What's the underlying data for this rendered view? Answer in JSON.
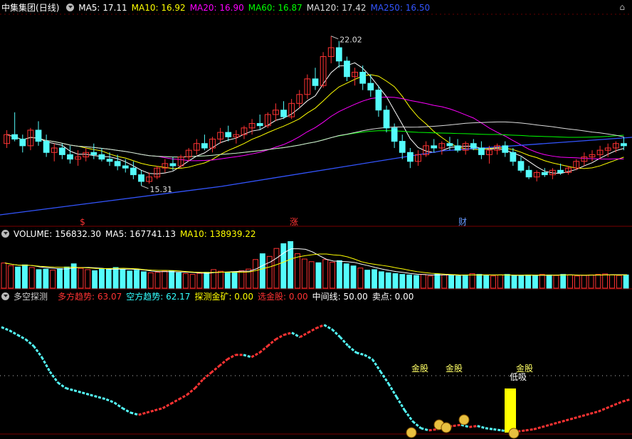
{
  "panel1": {
    "stock": "中集集团",
    "period": "(日线)",
    "indicators": [
      {
        "name": "MA5",
        "value": "17.11",
        "color": "#ffffff"
      },
      {
        "name": "MA10",
        "value": "16.92",
        "color": "#ffff00"
      },
      {
        "name": "MA20",
        "value": "16.90",
        "color": "#ff00ff"
      },
      {
        "name": "MA60",
        "value": "16.87",
        "color": "#00ff00"
      },
      {
        "name": "MA120",
        "value": "17.42",
        "color": "#dddddd"
      },
      {
        "name": "MA250",
        "value": "16.50",
        "color": "#3355ff"
      }
    ],
    "high_label": "22.02",
    "low_label": "15.31",
    "events": [
      "$",
      "涨",
      "财"
    ]
  },
  "panel2": {
    "title": "VOLUME",
    "items": [
      {
        "name": "VOLUME",
        "value": "156832.30",
        "color": "#ffffff"
      },
      {
        "name": "MA5",
        "value": "167741.13",
        "color": "#ffffff"
      },
      {
        "name": "MA10",
        "value": "138939.22",
        "color": "#ffff00"
      }
    ]
  },
  "panel3": {
    "title": "多空探测",
    "items": [
      {
        "name": "多方趋势",
        "value": "63.07",
        "color": "#ff3333"
      },
      {
        "name": "空方趋势",
        "value": "62.17",
        "color": "#33ffff"
      },
      {
        "name": "探测金矿",
        "value": "0.00",
        "color": "#ffff00"
      },
      {
        "name": "选金股",
        "value": "0.00",
        "color": "#ff3333"
      },
      {
        "name": "中间线",
        "value": "50.00",
        "color": "#ffffff"
      },
      {
        "name": "卖点",
        "value": "0.00",
        "color": "#ffffff"
      }
    ],
    "signals": [
      "金股",
      "金股",
      "金股"
    ],
    "low_buy": "低吸"
  },
  "colors": {
    "up": "#ff3333",
    "down": "#54fcfc",
    "bg": "#000000",
    "grid": "#7a0000"
  },
  "chart_data": {
    "type": "candlestick",
    "ohlc": [
      [
        17.2,
        17.8,
        17.0,
        17.6
      ],
      [
        17.6,
        18.6,
        17.3,
        17.4
      ],
      [
        17.4,
        17.6,
        16.8,
        17.1
      ],
      [
        17.1,
        17.9,
        16.9,
        17.8
      ],
      [
        17.8,
        18.2,
        17.1,
        17.3
      ],
      [
        17.3,
        17.6,
        16.6,
        16.8
      ],
      [
        16.8,
        17.2,
        16.4,
        17.0
      ],
      [
        17.0,
        17.2,
        16.5,
        16.7
      ],
      [
        16.7,
        17.1,
        16.3,
        16.5
      ],
      [
        16.5,
        16.9,
        16.2,
        16.6
      ],
      [
        16.6,
        17.0,
        16.4,
        16.8
      ],
      [
        16.8,
        17.2,
        16.5,
        16.7
      ],
      [
        16.7,
        17.0,
        16.4,
        16.5
      ],
      [
        16.5,
        16.8,
        16.2,
        16.4
      ],
      [
        16.4,
        16.7,
        16.0,
        16.2
      ],
      [
        16.2,
        16.5,
        15.9,
        16.1
      ],
      [
        16.1,
        16.4,
        15.6,
        15.8
      ],
      [
        15.8,
        16.0,
        15.31,
        15.5
      ],
      [
        15.5,
        15.9,
        15.4,
        15.7
      ],
      [
        15.7,
        16.2,
        15.6,
        16.1
      ],
      [
        16.1,
        16.5,
        15.9,
        16.3
      ],
      [
        16.3,
        16.6,
        16.0,
        16.2
      ],
      [
        16.2,
        16.7,
        16.1,
        16.6
      ],
      [
        16.6,
        17.0,
        16.4,
        16.9
      ],
      [
        16.9,
        17.4,
        16.7,
        17.2
      ],
      [
        17.2,
        17.6,
        16.9,
        17.0
      ],
      [
        17.0,
        17.5,
        16.8,
        17.4
      ],
      [
        17.4,
        17.9,
        17.2,
        17.7
      ],
      [
        17.7,
        18.0,
        17.3,
        17.5
      ],
      [
        17.5,
        17.8,
        17.2,
        17.6
      ],
      [
        17.6,
        18.0,
        17.4,
        17.9
      ],
      [
        17.9,
        18.3,
        17.6,
        18.1
      ],
      [
        18.1,
        18.5,
        17.8,
        18.0
      ],
      [
        18.0,
        18.6,
        17.9,
        18.5
      ],
      [
        18.5,
        19.0,
        18.2,
        18.7
      ],
      [
        18.7,
        19.1,
        18.3,
        18.4
      ],
      [
        18.4,
        19.2,
        18.3,
        19.0
      ],
      [
        19.0,
        19.6,
        18.8,
        19.4
      ],
      [
        19.4,
        20.3,
        19.2,
        20.1
      ],
      [
        20.1,
        20.6,
        19.6,
        19.8
      ],
      [
        19.8,
        21.3,
        19.7,
        21.1
      ],
      [
        21.1,
        22.02,
        20.8,
        21.5
      ],
      [
        21.5,
        21.8,
        20.6,
        20.9
      ],
      [
        20.9,
        21.1,
        20.0,
        20.2
      ],
      [
        20.2,
        20.6,
        19.8,
        20.4
      ],
      [
        20.4,
        20.7,
        19.6,
        19.9
      ],
      [
        19.9,
        20.3,
        19.3,
        19.6
      ],
      [
        19.6,
        19.8,
        18.4,
        18.7
      ],
      [
        18.7,
        18.9,
        17.7,
        17.9
      ],
      [
        17.9,
        18.1,
        17.0,
        17.3
      ],
      [
        17.3,
        17.6,
        16.5,
        16.8
      ],
      [
        16.8,
        17.0,
        16.1,
        16.4
      ],
      [
        16.4,
        16.9,
        16.2,
        16.7
      ],
      [
        16.7,
        17.3,
        16.6,
        17.1
      ],
      [
        17.1,
        17.4,
        16.8,
        17.0
      ],
      [
        17.0,
        17.3,
        16.7,
        17.2
      ],
      [
        17.2,
        17.5,
        16.9,
        17.1
      ],
      [
        17.1,
        17.4,
        16.8,
        16.9
      ],
      [
        16.9,
        17.3,
        16.7,
        17.2
      ],
      [
        17.2,
        17.4,
        16.9,
        17.0
      ],
      [
        17.0,
        17.3,
        16.5,
        16.7
      ],
      [
        16.7,
        17.1,
        16.3,
        16.9
      ],
      [
        16.9,
        17.2,
        16.7,
        17.1
      ],
      [
        17.1,
        17.3,
        16.6,
        16.8
      ],
      [
        16.8,
        17.0,
        16.2,
        16.4
      ],
      [
        16.4,
        16.6,
        15.9,
        16.0
      ],
      [
        16.0,
        16.2,
        15.6,
        15.7
      ],
      [
        15.7,
        16.0,
        15.5,
        15.9
      ],
      [
        15.9,
        16.1,
        15.7,
        15.8
      ],
      [
        15.8,
        16.1,
        15.6,
        16.0
      ],
      [
        16.0,
        16.3,
        15.8,
        15.9
      ],
      [
        15.9,
        16.2,
        15.8,
        16.1
      ],
      [
        16.1,
        16.5,
        16.0,
        16.4
      ],
      [
        16.4,
        16.8,
        16.2,
        16.6
      ],
      [
        16.6,
        16.9,
        16.4,
        16.7
      ],
      [
        16.7,
        17.1,
        16.5,
        16.9
      ],
      [
        16.9,
        17.2,
        16.6,
        17.0
      ],
      [
        17.0,
        17.3,
        16.8,
        17.2
      ],
      [
        17.2,
        17.5,
        16.9,
        17.1
      ]
    ],
    "volume": [
      95,
      85,
      80,
      88,
      78,
      70,
      72,
      68,
      74,
      80,
      92,
      75,
      70,
      66,
      72,
      74,
      78,
      70,
      65,
      68,
      62,
      58,
      60,
      64,
      66,
      58,
      55,
      52,
      56,
      60,
      70,
      64,
      58,
      62,
      66,
      72,
      108,
      130,
      120,
      150,
      168,
      176,
      130,
      110,
      100,
      96,
      108,
      98,
      104,
      92,
      84,
      76,
      68,
      70,
      62,
      58,
      55,
      52,
      50,
      48,
      52,
      46,
      54,
      50,
      48,
      46,
      50,
      55,
      52,
      48,
      46,
      50,
      52,
      48,
      46,
      50,
      48,
      52,
      50,
      48,
      52,
      50,
      46,
      48,
      50,
      52,
      54,
      50,
      48,
      50
    ],
    "oscillator": [
      95,
      92,
      88,
      84,
      78,
      68,
      55,
      45,
      40,
      38,
      36,
      34,
      32,
      30,
      27,
      22,
      18,
      16,
      18,
      20,
      22,
      26,
      30,
      34,
      40,
      48,
      54,
      60,
      66,
      70,
      70,
      68,
      72,
      78,
      84,
      88,
      90,
      86,
      90,
      94,
      97,
      93,
      86,
      78,
      72,
      70,
      66,
      55,
      44,
      32,
      20,
      10,
      4,
      2,
      3,
      5,
      6,
      7,
      5,
      6,
      4,
      3,
      2,
      1,
      1,
      2,
      3,
      5,
      7,
      9,
      11,
      13,
      15,
      17,
      19,
      22,
      25,
      28,
      30
    ],
    "ylim": [
      14.0,
      23.0
    ]
  }
}
